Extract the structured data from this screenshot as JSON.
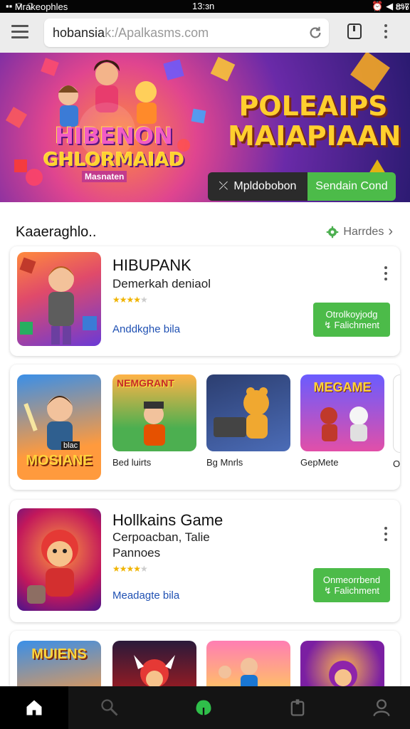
{
  "status_bar": {
    "left": "Mrakeophles",
    "time": "13:ɜn",
    "battery_text": "8%",
    "data_rate": "760M"
  },
  "browser": {
    "url_main": "hobansia",
    "url_rest": "k:/Apalkasms.com"
  },
  "banner": {
    "left_title_line1": "HIBENON",
    "left_title_line2": "GHLORMAIAD",
    "left_subtitle": "Masnaten",
    "right_title_line1": "POLEAIPS",
    "right_title_line2": "MAIAPIAAN",
    "button_dark_label": "Mpldobobon",
    "button_dark_icon": "⤫",
    "button_green_label": "Sendain Cond"
  },
  "section": {
    "title": "Kaaeraghlo..",
    "more_label": "Harrdes",
    "more_chevron": "›"
  },
  "featured": [
    {
      "title": "HIBUPANK",
      "subtitle": "Demerkah deniaol",
      "stars": "★★★★",
      "stars_off": "★",
      "link": "Anddkghe bila",
      "install_line1": "Otrolkoyjodg",
      "install_line2": "↯ Falichment"
    },
    {
      "title": "Hollkains Game",
      "subtitle": "Cerpoacban, Talie",
      "subtitle2": "Pannoes",
      "stars": "★★★★",
      "stars_off": "★",
      "link": "Meadagte bila",
      "install_line1": "Onmeorrbend",
      "install_line2": "↯ Falichment"
    }
  ],
  "row1": {
    "big_tile_text": "MOSIANE",
    "big_tile_tag": "blac",
    "items": [
      {
        "label": "Bed luirts",
        "tile_text": "NEMGRANT"
      },
      {
        "label": "Bg Mnrls",
        "tile_text": ""
      },
      {
        "label": "GepMete",
        "tile_text": "MEGAME"
      },
      {
        "label": "Ol"
      }
    ]
  },
  "row2": {
    "big_tile_text": "MUIENS"
  },
  "colors": {
    "accent_green": "#4cbb49",
    "link_blue": "#2051b3",
    "star_gold": "#f0b400"
  },
  "icons": [
    "menu-icon",
    "reload-icon",
    "tabs-icon",
    "more-vert-icon",
    "gear-icon",
    "home-icon",
    "search-icon",
    "apps-icon",
    "library-icon",
    "profile-icon"
  ]
}
